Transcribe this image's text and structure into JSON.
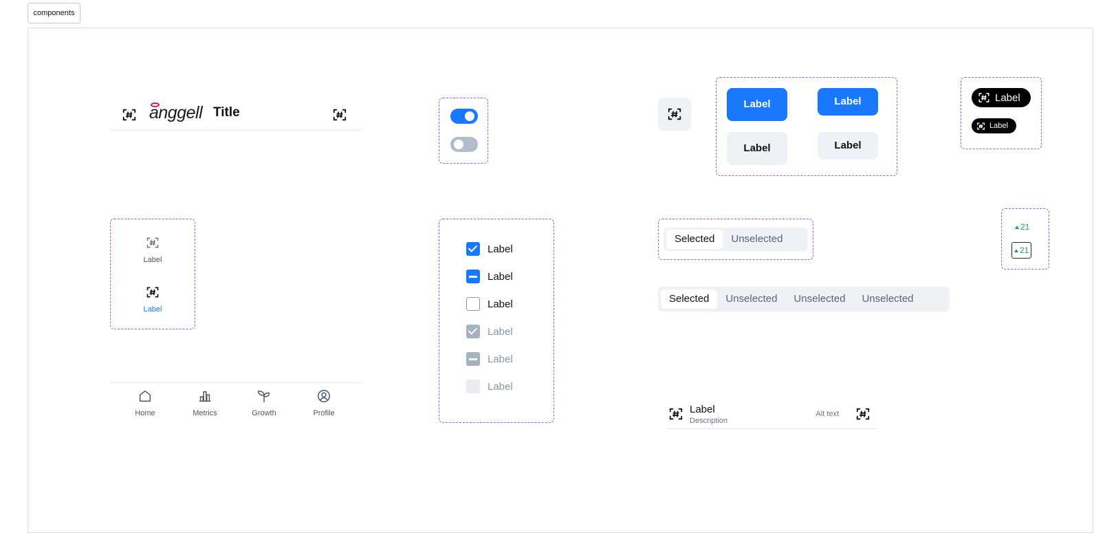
{
  "frame": {
    "tag": "components"
  },
  "header": {
    "logo": "anggell",
    "title": "Title"
  },
  "toggles": [
    {
      "state": "on"
    },
    {
      "state": "off"
    }
  ],
  "buttons": {
    "primary_large": "Label",
    "primary_small": "Label",
    "secondary_large": "Label",
    "secondary_small": "Label"
  },
  "chips": {
    "large": "Label",
    "small": "Label"
  },
  "vertical_tabs": [
    {
      "label": "Label",
      "state": "default"
    },
    {
      "label": "Label",
      "state": "active"
    }
  ],
  "checkboxes": [
    {
      "label": "Label",
      "state": "checked"
    },
    {
      "label": "Label",
      "state": "indeterminate"
    },
    {
      "label": "Label",
      "state": "unchecked"
    },
    {
      "label": "Label",
      "state": "disabled-checked"
    },
    {
      "label": "Label",
      "state": "disabled-indeterminate"
    },
    {
      "label": "Label",
      "state": "disabled-unchecked"
    }
  ],
  "segmented_small": {
    "options": [
      "Selected",
      "Unselected"
    ],
    "selected": 0
  },
  "segmented_large": {
    "options": [
      "Selected",
      "Unselected",
      "Unselected",
      "Unselected"
    ],
    "selected": 0
  },
  "stats": {
    "plain": "21",
    "boxed": "21"
  },
  "bottom_nav": {
    "items": [
      "Home",
      "Metrics",
      "Growth",
      "Profile"
    ]
  },
  "list_item": {
    "label": "Label",
    "description": "Description",
    "alt_text": "Alt text"
  },
  "colors": {
    "primary": "#1878ff",
    "dashed_outline": "#a855f7",
    "secondary_bg": "#eef1f5",
    "positive": "#1f9d63",
    "logo_accent": "#e0175f",
    "active_tab": "#1878ff"
  },
  "icons": {
    "placeholder": "scan-hash-icon",
    "home": "home-icon",
    "metrics": "bar-chart-icon",
    "growth": "sprout-icon",
    "profile": "user-circle-icon"
  }
}
